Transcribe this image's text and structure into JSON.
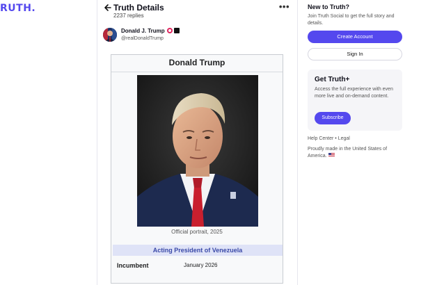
{
  "brand": {
    "logo_text": "RUTH."
  },
  "header": {
    "title": "Truth Details",
    "replies": "2237 replies",
    "more_icon": "more-horizontal-icon",
    "back_icon": "arrow-left-icon"
  },
  "post": {
    "author_name": "Donald J. Trump",
    "author_handle": "@realDonaldTrump"
  },
  "wiki": {
    "title": "Donald Trump",
    "caption": "Official portrait, 2025",
    "office": "Acting President of Venezuela",
    "row_label": "Incumbent",
    "row_value": "January 2026"
  },
  "sidebar": {
    "title": "New to Truth?",
    "description": "Join Truth Social to get the full story and details.",
    "create_label": "Create Account",
    "signin_label": "Sign In",
    "plus_title": "Get Truth+",
    "plus_desc": "Access the full experience with even more live and on-demand content.",
    "subscribe_label": "Subscribe",
    "footer_links": "Help Center • Legal",
    "made_in": "Proudly made in the United States of America."
  },
  "colors": {
    "brand": "#5448ee",
    "office_bar": "#dfe3f7",
    "office_text": "#3a49a8"
  }
}
